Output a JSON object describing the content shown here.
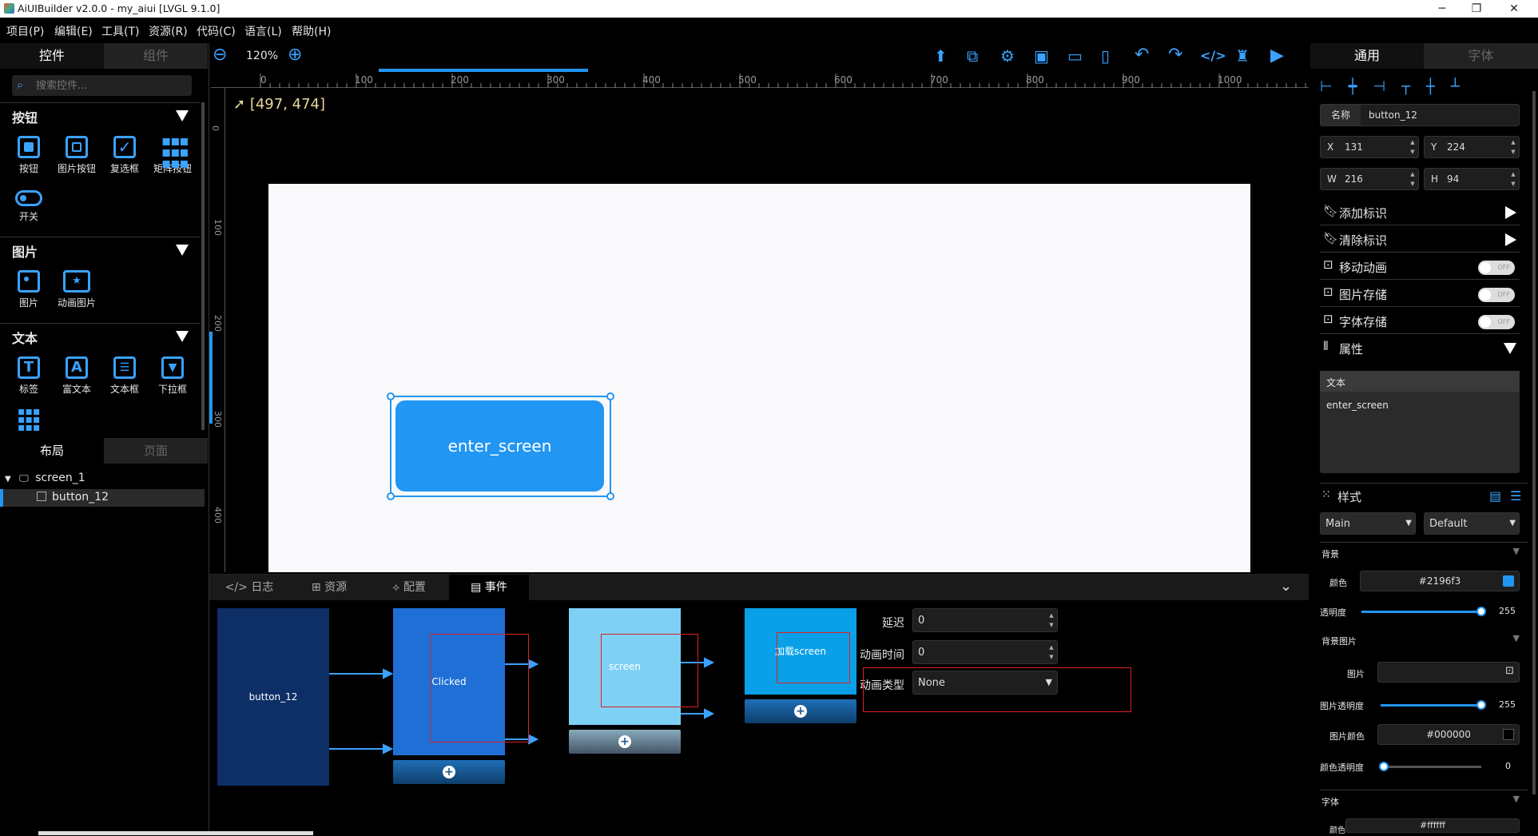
{
  "titlebar": {
    "title": "AiUIBuilder v2.0.0 - my_aiui [LVGL 9.1.0]",
    "minimize": "─",
    "restore": "❐",
    "close": "✕"
  },
  "menu": [
    "项目(P)",
    "编辑(E)",
    "工具(T)",
    "资源(R)",
    "代码(C)",
    "语言(L)",
    "帮助(H)"
  ],
  "left": {
    "tabs": [
      "控件",
      "组件"
    ],
    "search_placeholder": "搜索控件...",
    "sections": [
      {
        "title": "按钮",
        "items": [
          "按钮",
          "图片按钮",
          "复选框",
          "矩阵按钮",
          "开关"
        ]
      },
      {
        "title": "图片",
        "items": [
          "图片",
          "动画图片"
        ]
      },
      {
        "title": "文本",
        "items": [
          "标签",
          "富文本",
          "文本框",
          "下拉框"
        ]
      }
    ],
    "layout_tabs": [
      "布局",
      "页面"
    ],
    "tree": {
      "root": "screen_1",
      "child": "button_12"
    }
  },
  "toolbar": {
    "zoom": "120%"
  },
  "canvas": {
    "coord": "[497, 474]",
    "button_text": "enter_screen",
    "ruler_x": [
      "0",
      "100",
      "200",
      "300",
      "400",
      "500",
      "600",
      "700",
      "800",
      "900",
      "1000"
    ],
    "ruler_y": [
      "0",
      "100",
      "200",
      "300",
      "400"
    ]
  },
  "bottom": {
    "tabs": [
      "日志",
      "资源",
      "配置",
      "事件"
    ],
    "nodes": {
      "source": "button_12",
      "event": "Clicked",
      "target": "screen",
      "action": "加载screen"
    },
    "fields": {
      "delay_label": "延迟",
      "delay": "0",
      "anim_time_label": "动画时间",
      "anim_time": "0",
      "anim_type_label": "动画类型",
      "anim_type": "None"
    }
  },
  "right": {
    "tabs": [
      "通用",
      "字体"
    ],
    "name_label": "名称",
    "name": "button_12",
    "x_label": "X",
    "x": "131",
    "y_label": "Y",
    "y": "224",
    "w_label": "W",
    "w": "216",
    "h_label": "H",
    "h": "94",
    "rows": [
      "添加标识",
      "清除标识",
      "移动动画",
      "图片存储",
      "字体存储",
      "属性"
    ],
    "toggle_text": "OFF",
    "text_label": "文本",
    "text_value": "enter_screen",
    "style_label": "样式",
    "style_part": "Main",
    "style_state": "Default",
    "bg_label": "背景",
    "color_label": "颜色",
    "bg_color": "#2196f3",
    "opacity_label": "透明度",
    "opacity": "255",
    "bgimg_label": "背景图片",
    "img_label": "图片",
    "img_opa_label": "图片透明度",
    "img_opa": "255",
    "img_color_label": "图片颜色",
    "img_color": "#000000",
    "color_opa_label": "颜色透明度",
    "color_opa": "0",
    "font_label": "字体",
    "font_color_label": "颜色",
    "font_color": "#ffffff"
  },
  "colors": {
    "accent": "#2196f3",
    "node_dark": "#0d2f66",
    "node_blue": "#1f6fd6",
    "node_light": "#7fd0f5",
    "node_action": "#0aa0e8"
  }
}
